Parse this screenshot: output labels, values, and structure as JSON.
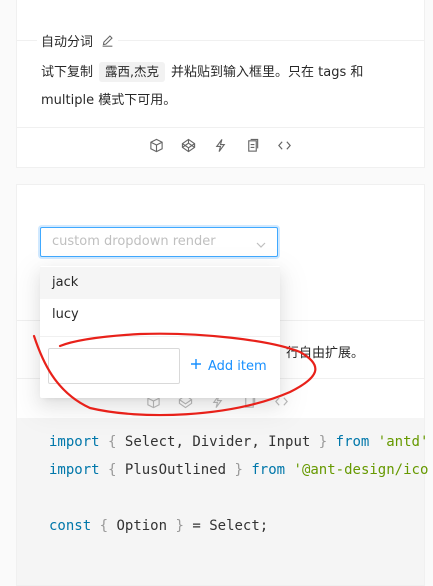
{
  "demo1": {
    "title": "自动分词",
    "desc_prefix": "试下复制",
    "desc_code": "露西,杰克",
    "desc_suffix": "并粘贴到输入框里。只在 tags 和",
    "desc_line2": "multiple 模式下可用。",
    "actions": [
      "codesandbox-icon",
      "codepen-icon",
      "thunderbolt-icon",
      "copy-icon",
      "code-icon"
    ]
  },
  "demo2": {
    "placeholder": "custom dropdown render",
    "desc_visible": "行自由扩展。",
    "options": [
      "jack",
      "lucy"
    ],
    "add_label": "Add item",
    "input_value": ""
  },
  "code": {
    "line1": [
      "import",
      "{",
      "Select, Divider, Input",
      "}",
      "from",
      "'antd'"
    ],
    "line2": [
      "import",
      "{",
      "PlusOutlined",
      "}",
      "from",
      "'@ant-design/ico"
    ],
    "line4": [
      "const",
      "{",
      "Option",
      "}",
      "= Select;"
    ]
  },
  "colors": {
    "accent": "#1890ff",
    "annotation": "#e8211a"
  }
}
